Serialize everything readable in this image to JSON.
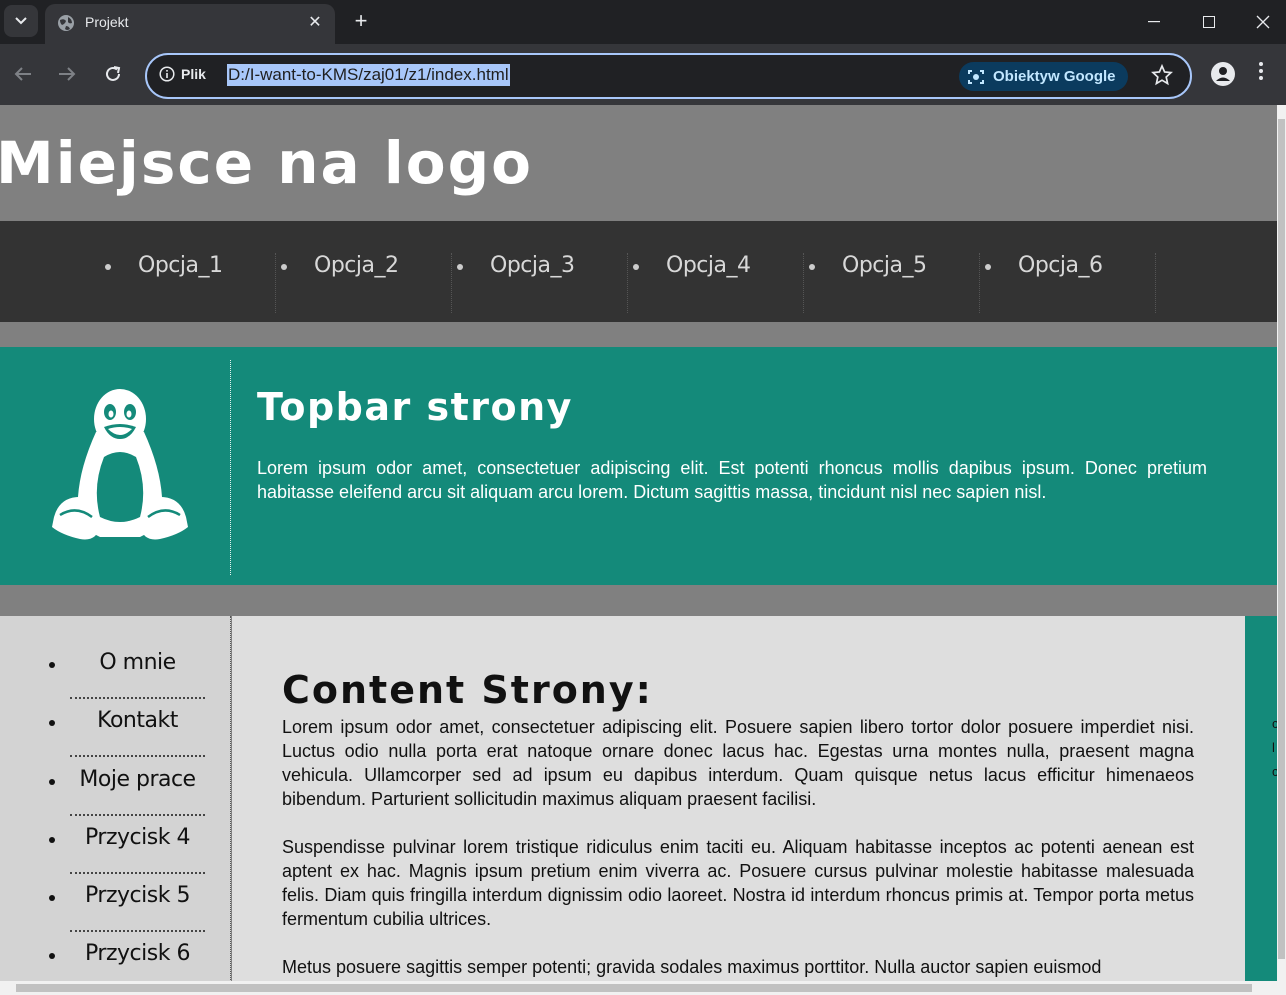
{
  "browser": {
    "tab_title": "Projekt",
    "close_glyph": "✕",
    "new_tab_glyph": "+",
    "site_info_label": "Plik",
    "url": "D:/I-want-to-KMS/zaj01/z1/index.html",
    "lens_label": "Obiektyw Google"
  },
  "page": {
    "logo": "Miejsce na logo",
    "nav": [
      "Opcja_1",
      "Opcja_2",
      "Opcja_3",
      "Opcja_4",
      "Opcja_5",
      "Opcja_6"
    ],
    "topbar": {
      "title": "Topbar strony",
      "text": "Lorem ipsum odor amet, consectetuer adipiscing elit. Est potenti rhoncus mollis dapibus ipsum. Donec pretium habitasse eleifend arcu sit aliquam arcu lorem. Dictum sagittis massa, tincidunt nisl nec sapien nisl."
    },
    "sidebar": [
      "O mnie",
      "Kontakt",
      "Moje prace",
      "Przycisk 4",
      "Przycisk 5",
      "Przycisk 6"
    ],
    "content": {
      "title": "Content Strony:",
      "paragraphs": [
        "Lorem ipsum odor amet, consectetuer adipiscing elit. Posuere sapien libero tortor dolor posuere imperdiet nisi. Luctus odio nulla porta erat natoque ornare donec lacus hac. Egestas urna montes nulla, praesent magna vehicula. Ullamcorper sed ad ipsum eu dapibus interdum. Quam quisque netus lacus efficitur himenaeos bibendum. Parturient sollicitudin maximus aliquam praesent facilisi.",
        "Suspendisse pulvinar lorem tristique ridiculus enim taciti eu. Aliquam habitasse inceptos ac potenti aenean est aptent ex hac. Magnis ipsum pretium enim viverra ac. Posuere cursus pulvinar molestie habitasse malesuada felis. Diam quis fringilla interdum dignissim odio laoreet. Nostra id interdum rhoncus primis at. Tempor porta metus fermentum cubilia ultrices.",
        "Metus posuere sagittis semper potenti; gravida sodales maximus porttitor. Nulla auctor sapien euismod"
      ]
    },
    "right_strip_peek": [
      "c",
      "l",
      "c"
    ]
  },
  "colors": {
    "chrome_bg": "#202124",
    "chrome_toolbar": "#35363a",
    "accent_focus": "#a8c7fa",
    "page_gray": "#808080",
    "nav_dark": "#333333",
    "teal": "#148a7a",
    "sidebar_bg": "#d3d3d3",
    "content_bg": "#dedede"
  },
  "icons": {
    "tab_menu": "chevron-down-icon",
    "tab_favicon": "globe-icon",
    "back": "arrow-left-icon",
    "forward": "arrow-right-icon",
    "reload": "reload-icon",
    "site_info": "info-icon",
    "lens": "camera-search-icon",
    "bookmark": "star-icon",
    "profile": "person-icon",
    "menu": "kebab-icon",
    "window_min": "minimize-icon",
    "window_max": "maximize-icon",
    "window_close": "close-icon",
    "tux": "penguin-icon"
  }
}
